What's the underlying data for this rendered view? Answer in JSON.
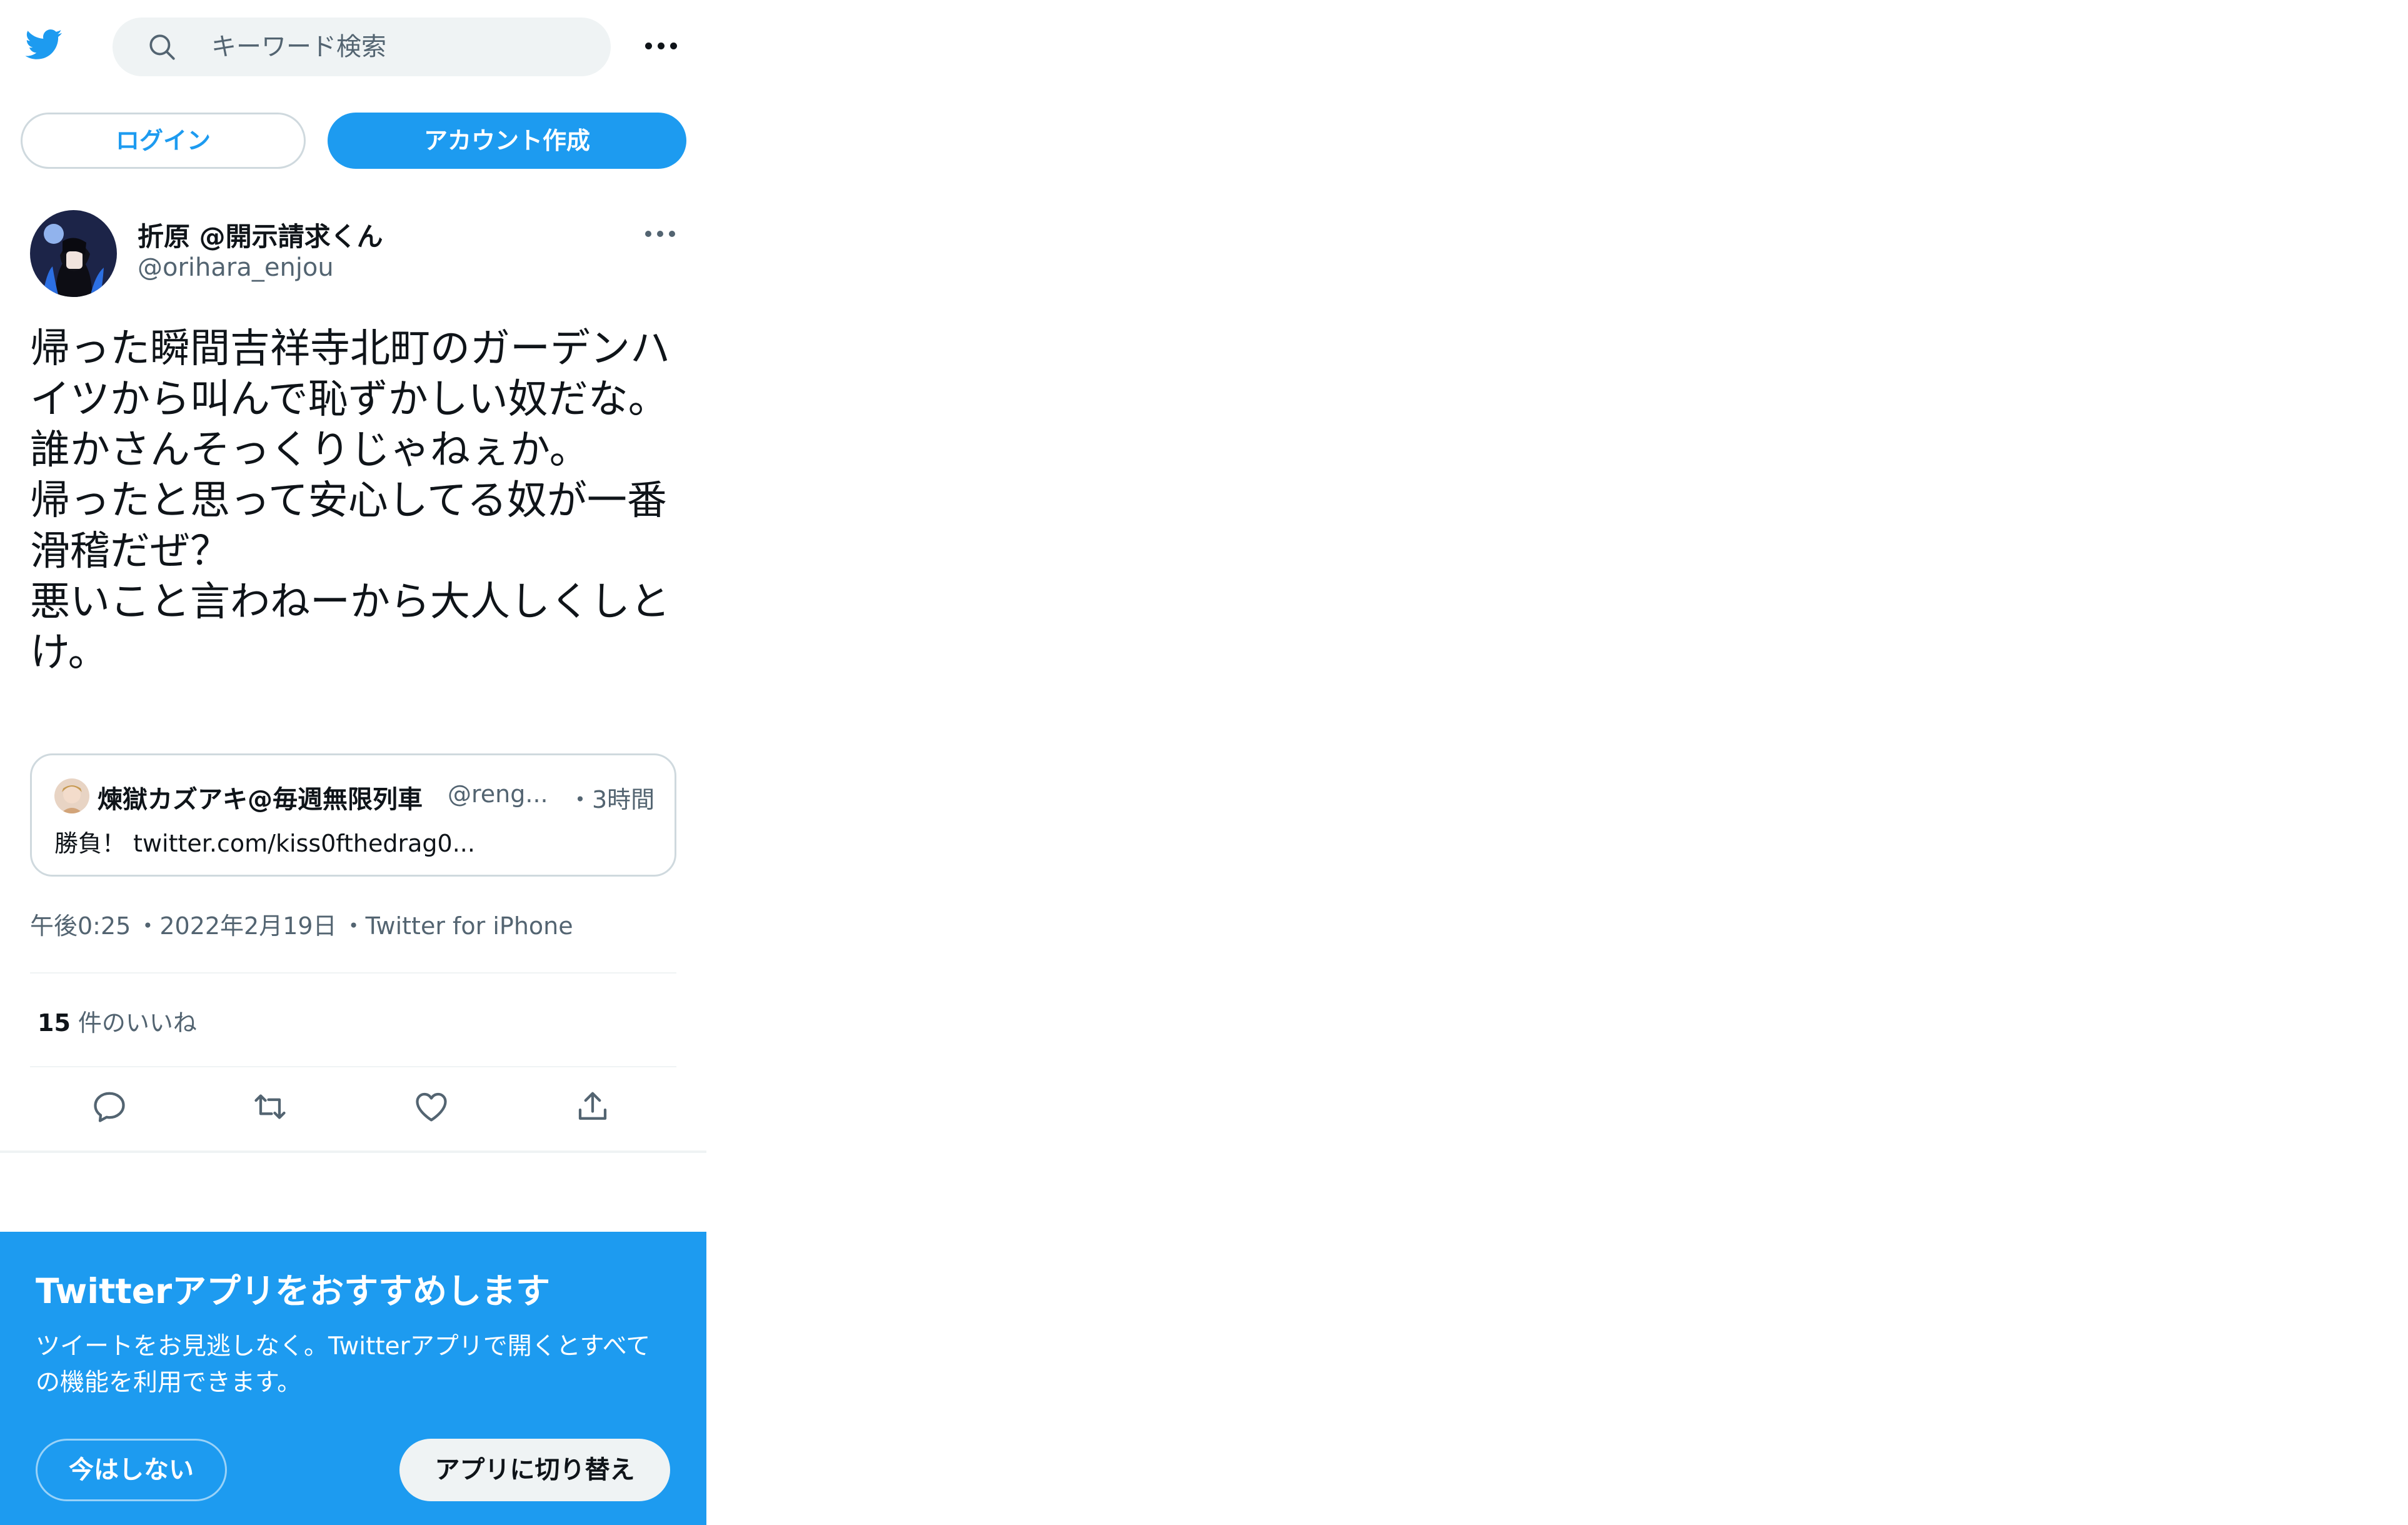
{
  "colors": {
    "brand": "#1d9bf0",
    "text_primary": "#0f1419",
    "text_secondary": "#536471",
    "border": "#cfd9de",
    "search_bg": "#eff3f4"
  },
  "header": {
    "logo_icon": "twitter-bird-icon",
    "search_icon": "search-icon",
    "search_placeholder": "キーワード検索",
    "more_icon": "more-horizontal-icon"
  },
  "auth": {
    "login_label": "ログイン",
    "signup_label": "アカウント作成"
  },
  "tweet": {
    "display_name": "折原 @開示請求くん",
    "username": "@orihara_enjou",
    "text": "帰った瞬間吉祥寺北町のガーデンハイツから叫んで恥ずかしい奴だな。\n誰かさんそっくりじゃねぇか。\n帰ったと思って安心してる奴が一番滑稽だぜ？\n悪いこと言わねーから大人しくしとけ。",
    "quote": {
      "display_name": "煉獄カズアキ@毎週無限列車",
      "handle": "@reng...",
      "time": "・3時間",
      "text": "勝負！ twitter.com/kiss0fthedrag0..."
    },
    "meta": {
      "time": "午後0:25",
      "date": "・2022年2月19日",
      "source": "・Twitter for iPhone"
    },
    "likes_count": "15",
    "likes_label": "件のいいね",
    "actions": [
      "reply-icon",
      "retweet-icon",
      "like-icon",
      "share-icon"
    ]
  },
  "banner": {
    "title": "Twitterアプリをおすすめします",
    "description": "ツイートをお見逃しなく。Twitterアプリで開くとすべての機能を利用できます。",
    "dismiss_label": "今はしない",
    "switch_label": "アプリに切り替え"
  }
}
